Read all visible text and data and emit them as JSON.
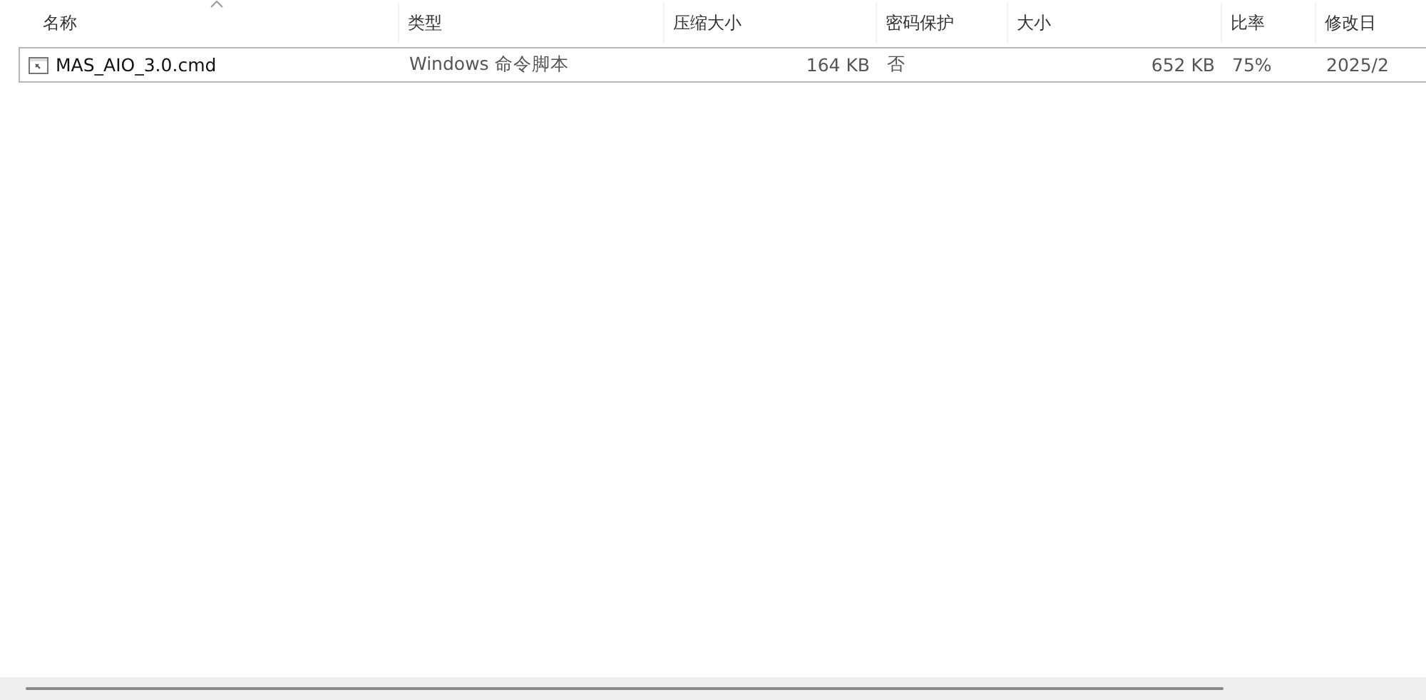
{
  "table": {
    "columns": [
      {
        "label": "名称",
        "sorted": true
      },
      {
        "label": "类型",
        "sorted": false
      },
      {
        "label": "压缩大小",
        "sorted": false
      },
      {
        "label": "密码保护",
        "sorted": false
      },
      {
        "label": "大小",
        "sorted": false
      },
      {
        "label": "比率",
        "sorted": false
      },
      {
        "label": "修改日",
        "sorted": false
      }
    ],
    "rows": [
      {
        "selected": true,
        "cells": [
          "MAS_AIO_3.0.cmd",
          "Windows 命令脚本",
          "164 KB",
          "否",
          "652 KB",
          "75%",
          "2025/2"
        ]
      }
    ]
  }
}
